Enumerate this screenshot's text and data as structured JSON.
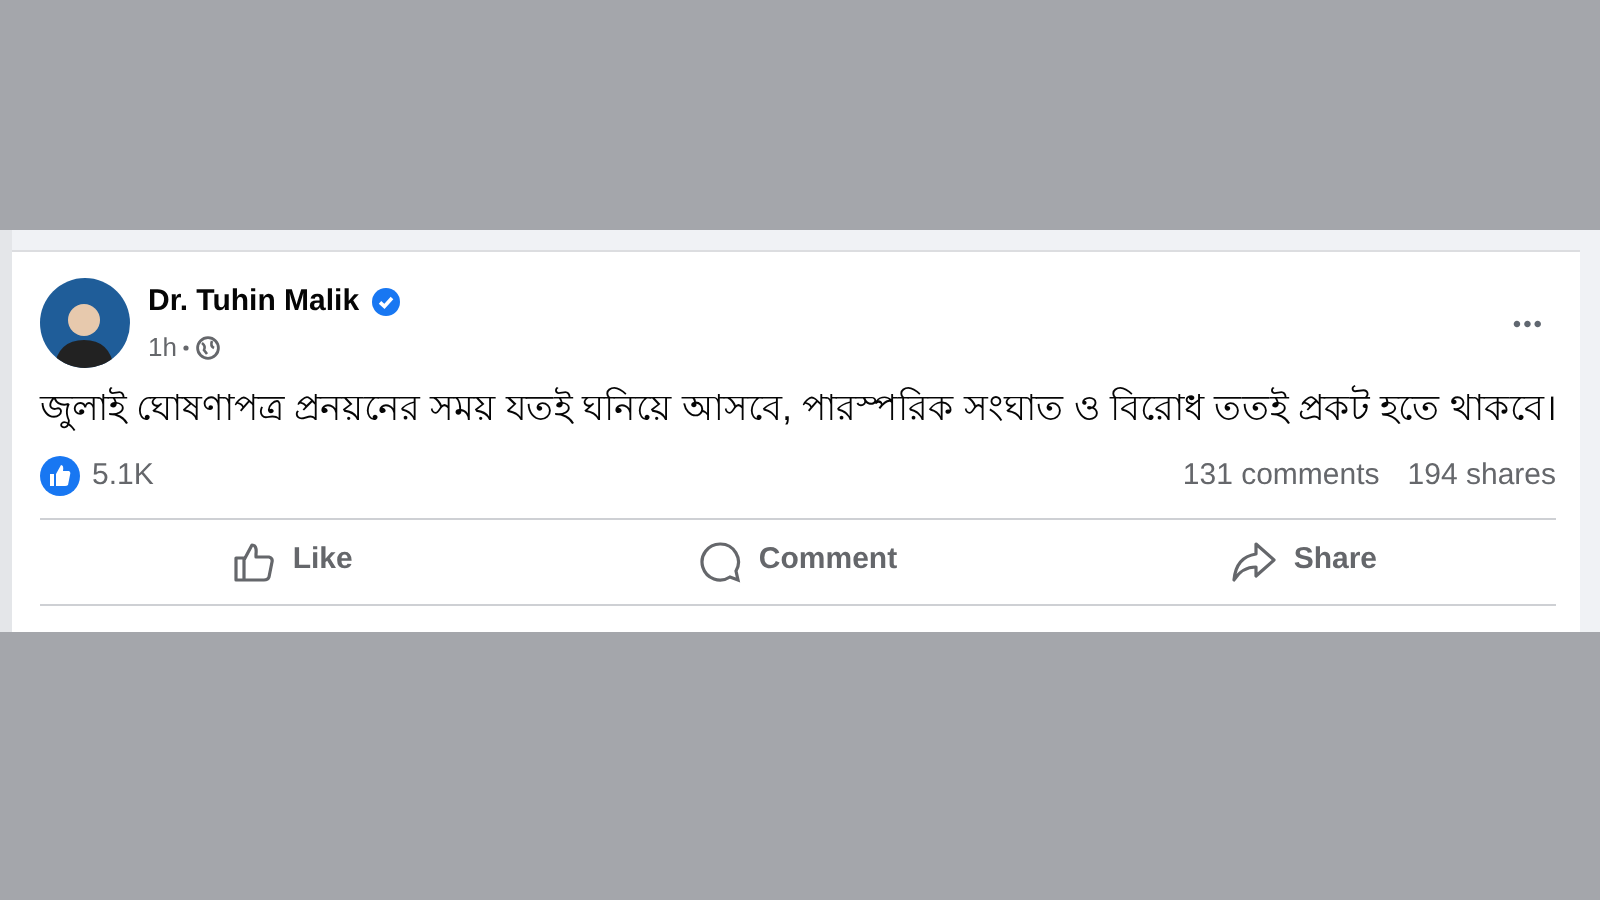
{
  "post": {
    "author": "Dr. Tuhin Malik",
    "verified": true,
    "time": "1h",
    "more": "•••",
    "text": "জুলাই ঘোষণাপত্র প্রনয়নের সময় যতই ঘনিয়ে আসবে, পারস্পরিক সংঘাত ও বিরোধ ততই প্রকট হতে থাকবে।",
    "reactions": "5.1K",
    "comments": "131 comments",
    "shares": "194 shares",
    "actions": [
      {
        "kind": "like",
        "label": "Like"
      },
      {
        "kind": "comment",
        "label": "Comment"
      },
      {
        "kind": "share",
        "label": "Share"
      }
    ]
  }
}
